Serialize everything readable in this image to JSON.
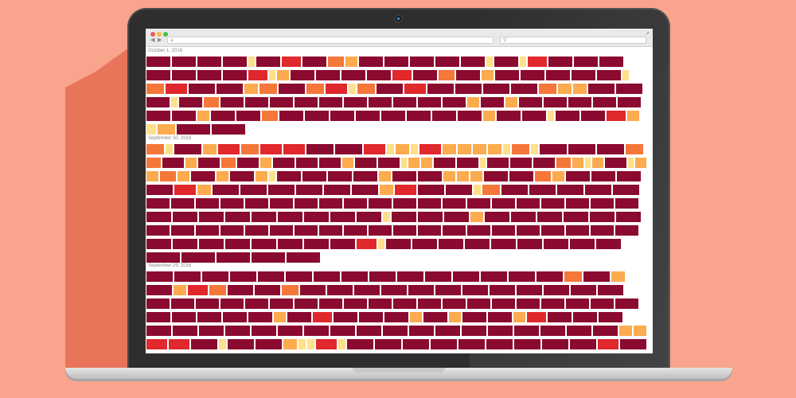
{
  "browser": {
    "address_text": "a",
    "search_icon": "search-icon",
    "back_icon": "back-arrow-icon",
    "forward_icon": "forward-arrow-icon"
  },
  "colors": {
    "background": "#f9a48c",
    "maroon": "#8b0a2f",
    "red": "#e0282d",
    "orange": "#f5773a",
    "light_orange": "#fdab4f",
    "yellow": "#ffe08a"
  },
  "sections": [
    {
      "date": "October 1, 2016",
      "rows": [
        [
          "m",
          "m",
          "m",
          "m",
          "y",
          "m",
          "r",
          "m",
          "o",
          "lo",
          "m",
          "m",
          "m",
          "m",
          "m",
          "y",
          "m",
          "y",
          "r",
          "m",
          "m",
          "m",
          "m"
        ],
        [
          "m",
          "m",
          "m",
          "m",
          "r",
          "y",
          "lo",
          "m",
          "m",
          "m",
          "m",
          "r",
          "m",
          "o",
          "m",
          "lo",
          "m",
          "m",
          "m",
          "m",
          "m",
          "y",
          "r"
        ],
        [
          "o",
          "r",
          "m",
          "m",
          "lo",
          "o",
          "m",
          "o",
          "r",
          "y",
          "o",
          "m",
          "r",
          "m",
          "m",
          "m",
          "m",
          "o",
          "lo",
          "lo",
          "m",
          "m"
        ],
        [
          "m",
          "y",
          "m",
          "o",
          "m",
          "m",
          "m",
          "m",
          "m",
          "m",
          "m",
          "m",
          "m",
          "m",
          "lo",
          "m",
          "lo",
          "m",
          "m",
          "m",
          "m",
          "m"
        ],
        [
          "m",
          "m",
          "lo",
          "m",
          "m",
          "o",
          "m",
          "m",
          "m",
          "m",
          "m",
          "m",
          "m",
          "m",
          "lo",
          "m",
          "m",
          "y",
          "m",
          "m",
          "r",
          "lo",
          "y"
        ],
        [
          "y",
          "lo",
          "m",
          "m"
        ]
      ]
    },
    {
      "date": "September 30, 2016",
      "rows": [
        [
          "o",
          "y",
          "m",
          "lo",
          "r",
          "o",
          "r",
          "r",
          "m",
          "m",
          "r",
          "y",
          "lo",
          "y",
          "r",
          "lo",
          "lo",
          "lo",
          "lo",
          "y",
          "o",
          "y",
          "m",
          "m",
          "m",
          "o"
        ],
        [
          "o",
          "m",
          "lo",
          "m",
          "o",
          "m",
          "lo",
          "m",
          "m",
          "m",
          "lo",
          "m",
          "m",
          "y",
          "lo",
          "lo",
          "m",
          "m",
          "y",
          "m",
          "m",
          "m",
          "o",
          "lo",
          "y",
          "lo",
          "m",
          "y",
          "lo"
        ],
        [
          "lo",
          "o",
          "lo",
          "m",
          "lo",
          "m",
          "lo",
          "y",
          "m",
          "m",
          "m",
          "m",
          "lo",
          "m",
          "m",
          "lo",
          "lo",
          "lo",
          "m",
          "m",
          "o",
          "lo",
          "m",
          "m",
          "m"
        ],
        [
          "m",
          "r",
          "lo",
          "m",
          "m",
          "m",
          "m",
          "m",
          "m",
          "lo",
          "r",
          "m",
          "m",
          "y",
          "o",
          "m",
          "m",
          "m",
          "m",
          "m"
        ],
        [
          "m",
          "m",
          "m",
          "m",
          "m",
          "m",
          "m",
          "m",
          "m",
          "m",
          "m",
          "m",
          "m",
          "m",
          "m",
          "m",
          "m",
          "m",
          "m",
          "m"
        ],
        [
          "m",
          "m",
          "m",
          "m",
          "m",
          "m",
          "m",
          "m",
          "m",
          "y",
          "m",
          "m",
          "m",
          "lo",
          "m",
          "m",
          "m",
          "m",
          "m",
          "m"
        ],
        [
          "m",
          "m",
          "m",
          "m",
          "m",
          "m",
          "m",
          "m",
          "m",
          "m",
          "m",
          "m",
          "m",
          "m",
          "m",
          "m",
          "m",
          "m",
          "m",
          "m"
        ],
        [
          "m",
          "m",
          "m",
          "m",
          "m",
          "m",
          "m",
          "m",
          "r",
          "y",
          "m",
          "m",
          "m",
          "m",
          "m",
          "m",
          "m",
          "m",
          "m",
          "m"
        ],
        [
          "m",
          "m",
          "m",
          "m",
          "m"
        ]
      ]
    },
    {
      "date": "September 29, 2016",
      "rows": [
        [
          "m",
          "m",
          "m",
          "m",
          "m",
          "m",
          "m",
          "m",
          "m",
          "m",
          "m",
          "m",
          "m",
          "m",
          "m",
          "o",
          "m",
          "lo",
          "r"
        ],
        [
          "m",
          "lo",
          "r",
          "o",
          "m",
          "m",
          "o",
          "m",
          "m",
          "m",
          "m",
          "m",
          "m",
          "m",
          "m",
          "m",
          "m",
          "m",
          "m",
          "m"
        ],
        [
          "m",
          "m",
          "m",
          "m",
          "m",
          "m",
          "m",
          "m",
          "m",
          "m",
          "m",
          "m",
          "m",
          "m",
          "m",
          "m",
          "m",
          "m",
          "m",
          "m"
        ],
        [
          "m",
          "m",
          "m",
          "m",
          "m",
          "lo",
          "m",
          "r",
          "m",
          "m",
          "m",
          "lo",
          "m",
          "lo",
          "m",
          "m",
          "lo",
          "r",
          "m",
          "m",
          "m",
          "m"
        ],
        [
          "m",
          "m",
          "m",
          "m",
          "m",
          "m",
          "m",
          "m",
          "m",
          "m",
          "m",
          "m",
          "m",
          "m",
          "m",
          "m",
          "m",
          "m",
          "lo",
          "lo"
        ],
        [
          "r",
          "r",
          "m",
          "y",
          "m",
          "m",
          "lo",
          "y",
          "y",
          "r",
          "y",
          "m",
          "m",
          "m",
          "m",
          "m",
          "m",
          "m",
          "m",
          "m",
          "r",
          "m"
        ]
      ]
    }
  ]
}
